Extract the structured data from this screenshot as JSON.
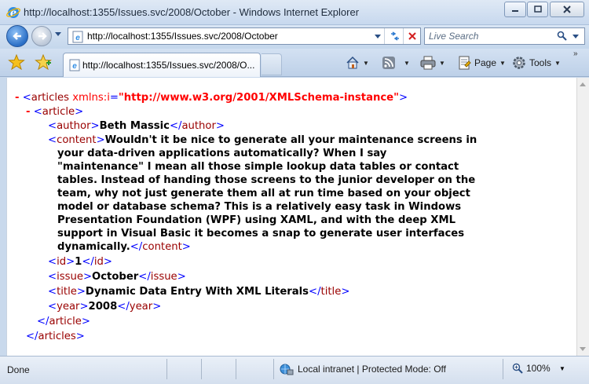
{
  "window": {
    "title": "http://localhost:1355/Issues.svc/2008/October - Windows Internet Explorer"
  },
  "address_bar": {
    "url": "http://localhost:1355/Issues.svc/2008/October",
    "search_placeholder": "Live Search"
  },
  "tab": {
    "label": "http://localhost:1355/Issues.svc/2008/O..."
  },
  "command_bar": {
    "page_label": "Page",
    "tools_label": "Tools"
  },
  "xml": {
    "articles_tag": "articles",
    "xmlns_attr": "xmlns:i",
    "xmlns_value": "\"http://www.w3.org/2001/XMLSchema-instance\"",
    "article_tag": "article",
    "author_tag": "author",
    "author_value": "Beth Massic",
    "content_tag": "content",
    "content_lines": [
      "Wouldn't it be nice to generate all your maintenance screens in",
      "your data-driven applications automatically? When I say",
      "\"maintenance\" I mean all those simple lookup data tables or contact",
      "tables. Instead of handing those screens to the junior developer on the",
      "team, why not just generate them all at run time based on your object",
      "model or database schema? This is a relatively easy task in Windows",
      "Presentation Foundation (WPF) using XAML, and with the deep XML",
      "support in Visual Basic it becomes a snap to generate user interfaces",
      "dynamically."
    ],
    "id_tag": "id",
    "id_value": "1",
    "issue_tag": "issue",
    "issue_value": "October",
    "title_tag": "title",
    "title_value": "Dynamic Data Entry With XML Literals",
    "year_tag": "year",
    "year_value": "2008",
    "minus_glyph": "-"
  },
  "status_bar": {
    "status_text": "Done",
    "zone_text": "Local intranet | Protected Mode: Off",
    "zoom_text": "100%"
  },
  "colors": {
    "tag_name": "#990000",
    "bracket": "#0000ff",
    "attribute": "#ff0000"
  }
}
